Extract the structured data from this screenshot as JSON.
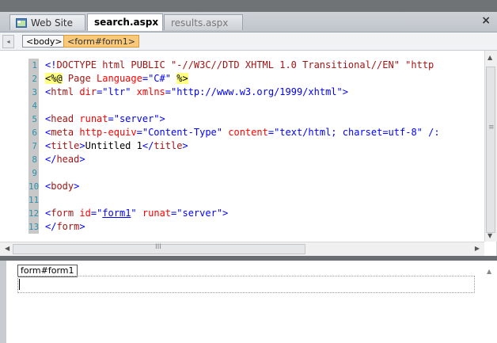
{
  "tabs": [
    {
      "label": "Web Site"
    },
    {
      "label": "search.aspx"
    },
    {
      "label": "results.aspx"
    }
  ],
  "close_label": "×",
  "tag_nav": {
    "body": "<body>",
    "form": "<form#form1>"
  },
  "code_lines": [
    {
      "n": "1",
      "text": "<!DOCTYPE html PUBLIC \"-//W3C//DTD XHTML 1.0 Transitional//EN\" \"http"
    },
    {
      "n": "2",
      "text": "<%@ Page Language=\"C#\" %>"
    },
    {
      "n": "3",
      "text": "<html dir=\"ltr\" xmlns=\"http://www.w3.org/1999/xhtml\">"
    },
    {
      "n": "4",
      "text": ""
    },
    {
      "n": "5",
      "text": "<head runat=\"server\">"
    },
    {
      "n": "6",
      "text": "<meta http-equiv=\"Content-Type\" content=\"text/html; charset=utf-8\" /:"
    },
    {
      "n": "7",
      "text": "<title>Untitled 1</title>"
    },
    {
      "n": "8",
      "text": "</head>"
    },
    {
      "n": "9",
      "text": ""
    },
    {
      "n": "10",
      "text": "<body>"
    },
    {
      "n": "11",
      "text": ""
    },
    {
      "n": "12",
      "text": "<form id=\"form1\" runat=\"server\">"
    },
    {
      "n": "13",
      "text": "</form>"
    }
  ],
  "design": {
    "form_tag": "form#form1"
  },
  "colors": {
    "tag": "#a31515",
    "attr": "#ff0000",
    "value": "#0000ff",
    "gutter": "#c8c8c8",
    "line_number": "#2b91af",
    "active_crumb": "#f9c97a"
  },
  "icons": {
    "website_tab": "website-icon"
  }
}
